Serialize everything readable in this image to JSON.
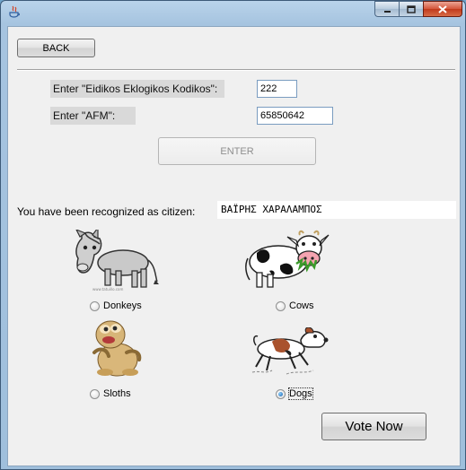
{
  "toolbar": {
    "back_label": "BACK"
  },
  "form": {
    "code_label": "Enter \"Eidikos Eklogikos Kodikos\":",
    "code_value": "222",
    "afm_label": "Enter \"AFM\":",
    "afm_value": "65850642",
    "enter_label": "ENTER"
  },
  "citizen": {
    "label": "You have been recognized as citizen:",
    "name": "ΒΑΪΡΗΣ ΧΑΡΑΛΑΜΠΟΣ"
  },
  "options": [
    {
      "label": "Donkeys",
      "selected": false,
      "icon": "donkey-icon"
    },
    {
      "label": "Cows",
      "selected": false,
      "icon": "cow-icon"
    },
    {
      "label": "Sloths",
      "selected": false,
      "icon": "sloth-icon"
    },
    {
      "label": "Dogs",
      "selected": true,
      "icon": "dog-icon"
    }
  ],
  "vote_label": "Vote Now",
  "colors": {
    "title_bar": "#a6c4e0",
    "close_button": "#c03a1c",
    "client_bg": "#f0f0f0"
  }
}
